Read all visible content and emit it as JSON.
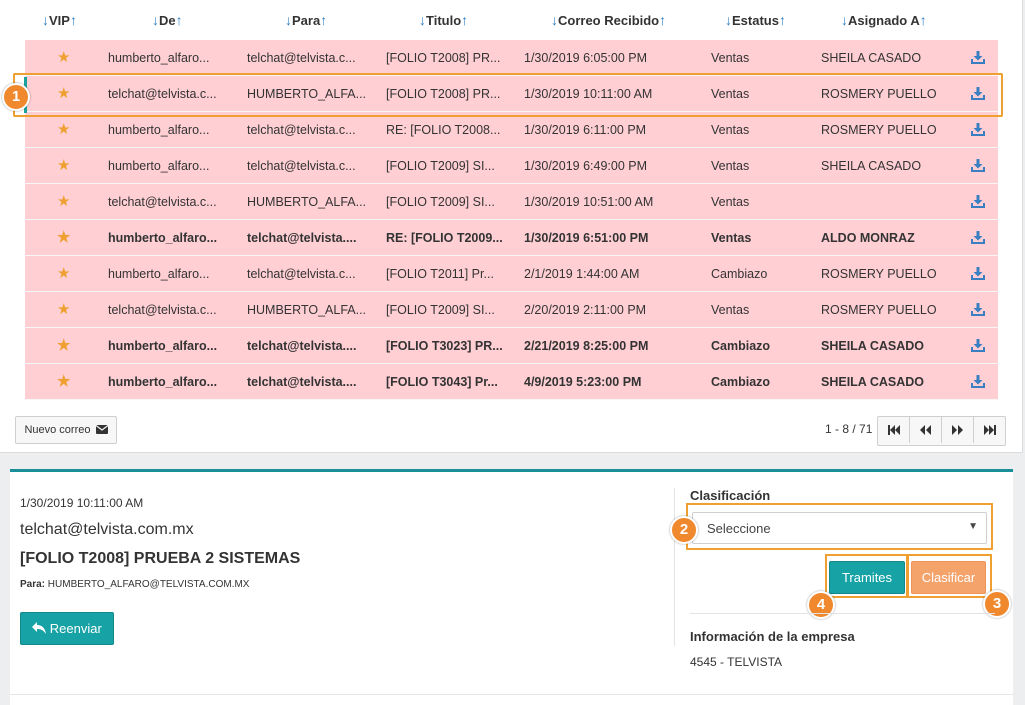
{
  "table": {
    "columns": [
      {
        "key": "vip",
        "label": "VIP",
        "has_down": true,
        "has_up": true
      },
      {
        "key": "de",
        "label": "De",
        "has_down": true,
        "has_up": true
      },
      {
        "key": "para",
        "label": "Para",
        "has_down": true,
        "has_up": true
      },
      {
        "key": "titulo",
        "label": "Titulo",
        "has_down": true,
        "has_up": true
      },
      {
        "key": "recibido",
        "label": "Correo Recibido",
        "has_down": true,
        "has_up": true
      },
      {
        "key": "estatus",
        "label": "Estatus",
        "has_down": true,
        "has_up": true
      },
      {
        "key": "asignado",
        "label": "Asignado A",
        "has_down": true,
        "has_up": true
      }
    ],
    "arrow_down": "↓",
    "arrow_up": "↑",
    "rows": [
      {
        "de": "humberto_alfaro...",
        "para": "telchat@telvista.c...",
        "titulo": "[FOLIO T2008] PR...",
        "recibido": "1/30/2019 6:05:00 PM",
        "estatus": "Ventas",
        "asignado": "SHEILA CASADO",
        "bold": false
      },
      {
        "de": "telchat@telvista.c...",
        "para": "HUMBERTO_ALFA...",
        "titulo": "[FOLIO T2008] PR...",
        "recibido": "1/30/2019 10:11:00 AM",
        "estatus": "Ventas",
        "asignado": "ROSMERY PUELLO",
        "bold": false,
        "selected": true
      },
      {
        "de": "humberto_alfaro...",
        "para": "telchat@telvista.c...",
        "titulo": "RE: [FOLIO T2008...",
        "recibido": "1/30/2019 6:11:00 PM",
        "estatus": "Ventas",
        "asignado": "ROSMERY PUELLO",
        "bold": false
      },
      {
        "de": "humberto_alfaro...",
        "para": "telchat@telvista.c...",
        "titulo": "[FOLIO T2009] SI...",
        "recibido": "1/30/2019 6:49:00 PM",
        "estatus": "Ventas",
        "asignado": "SHEILA CASADO",
        "bold": false
      },
      {
        "de": "telchat@telvista.c...",
        "para": "HUMBERTO_ALFA...",
        "titulo": "[FOLIO T2009] SI...",
        "recibido": "1/30/2019 10:51:00 AM",
        "estatus": "Ventas",
        "asignado": "",
        "bold": false
      },
      {
        "de": "humberto_alfaro...",
        "para": "telchat@telvista....",
        "titulo": "RE: [FOLIO T2009...",
        "recibido": "1/30/2019 6:51:00 PM",
        "estatus": "Ventas",
        "asignado": "ALDO MONRAZ",
        "bold": true
      },
      {
        "de": "humberto_alfaro...",
        "para": "telchat@telvista.c...",
        "titulo": "[FOLIO T2011] Pr...",
        "recibido": "2/1/2019 1:44:00 AM",
        "estatus": "Cambiazo",
        "asignado": "ROSMERY PUELLO",
        "bold": false
      },
      {
        "de": "telchat@telvista.c...",
        "para": "HUMBERTO_ALFA...",
        "titulo": "[FOLIO T2009] SI...",
        "recibido": "2/20/2019 2:11:00 PM",
        "estatus": "Ventas",
        "asignado": "ROSMERY PUELLO",
        "bold": false
      },
      {
        "de": "humberto_alfaro...",
        "para": "telchat@telvista....",
        "titulo": "[FOLIO T3023] PR...",
        "recibido": "2/21/2019 8:25:00 PM",
        "estatus": "Cambiazo",
        "asignado": "SHEILA CASADO",
        "bold": true
      },
      {
        "de": "humberto_alfaro...",
        "para": "telchat@telvista....",
        "titulo": "[FOLIO T3043] Pr...",
        "recibido": "4/9/2019 5:23:00 PM",
        "estatus": "Cambiazo",
        "asignado": "SHEILA CASADO",
        "bold": true
      }
    ]
  },
  "toolbar": {
    "new_mail_label": "Nuevo correo"
  },
  "pager": {
    "text": "1 - 8 / 71"
  },
  "detail": {
    "date": "1/30/2019 10:11:00 AM",
    "from": "telchat@telvista.com.mx",
    "subject": "[FOLIO T2008] PRUEBA 2 SISTEMAS",
    "para_label": "Para:",
    "para_value": "HUMBERTO_ALFARO@TELVISTA.COM.MX",
    "reenviar_label": "Reenviar"
  },
  "classification": {
    "label": "Clasificación",
    "select_value": "Seleccione",
    "tramites_label": "Tramites",
    "clasificar_label": "Clasificar",
    "info_label": "Información de la empresa",
    "info_value": "4545 - TELVISTA"
  },
  "badges": [
    "1",
    "2",
    "3",
    "4"
  ],
  "colors": {
    "row_bg": "#ffcfd4",
    "accent": "#17a2a5",
    "orange": "#f0882e",
    "star": "#f0a030",
    "link_blue": "#2f7fc1"
  }
}
